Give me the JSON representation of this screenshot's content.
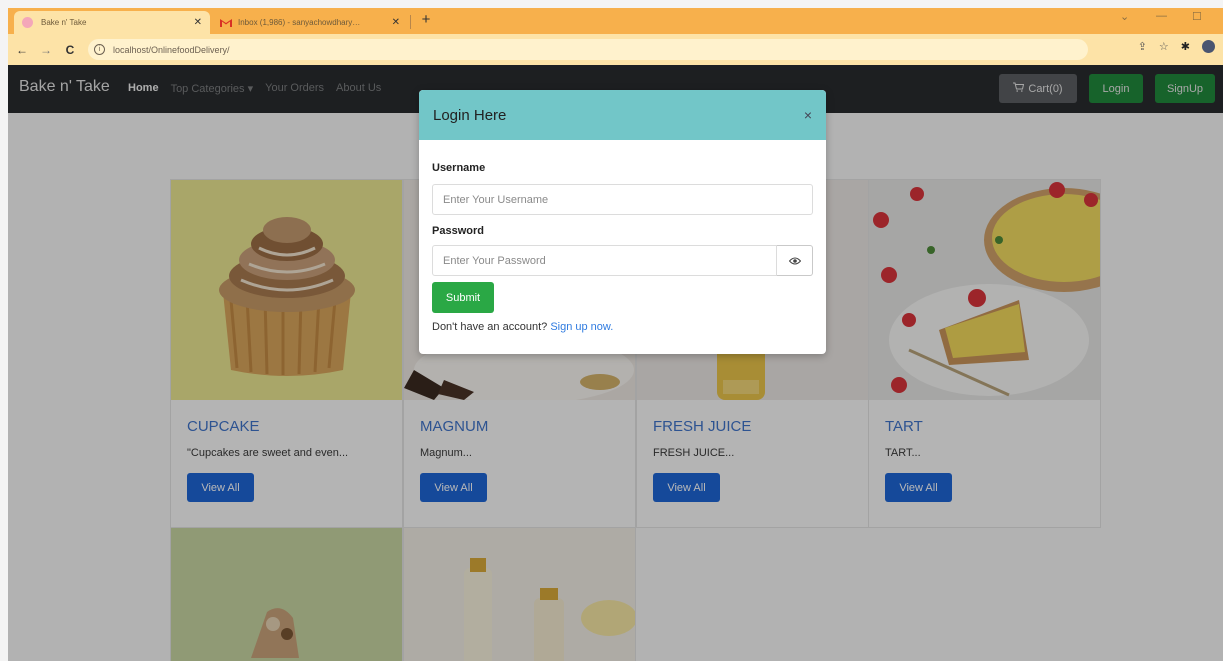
{
  "browser": {
    "tabs": [
      {
        "label": "Bake n' Take",
        "favicon_color": "#f4a7b9"
      },
      {
        "label": "Inbox (1,986) - sanyachowdhary…",
        "favicon_color": "#d93025"
      }
    ],
    "url": "localhost/OnlinefoodDelivery/"
  },
  "navbar": {
    "brand": "Bake n' Take",
    "links": [
      "Home",
      "Top Categories ▾",
      "Your Orders",
      "About Us"
    ],
    "cart_label": "Cart(0)",
    "login_label": "Login",
    "signup_label": "SignUp"
  },
  "cards": [
    {
      "title": "CUPCAKE",
      "desc": "\"Cupcakes are sweet and even...",
      "button": "View All"
    },
    {
      "title": "MAGNUM",
      "desc": "Magnum...",
      "button": "View All"
    },
    {
      "title": "FRESH JUICE",
      "desc": "FRESH JUICE...",
      "button": "View All"
    },
    {
      "title": "TART",
      "desc": "TART...",
      "button": "View All"
    }
  ],
  "modal": {
    "title": "Login Here",
    "close_symbol": "×",
    "username_label": "Username",
    "username_placeholder": "Enter Your Username",
    "password_label": "Password",
    "password_placeholder": "Enter Your Password",
    "submit_label": "Submit",
    "signup_prompt": "Don't have an account?",
    "signup_link": "Sign up now."
  },
  "colors": {
    "navbar_bg": "#292b2e",
    "modal_header": "#72c6c8",
    "primary": "#1e66d6",
    "success": "#2aa845"
  }
}
